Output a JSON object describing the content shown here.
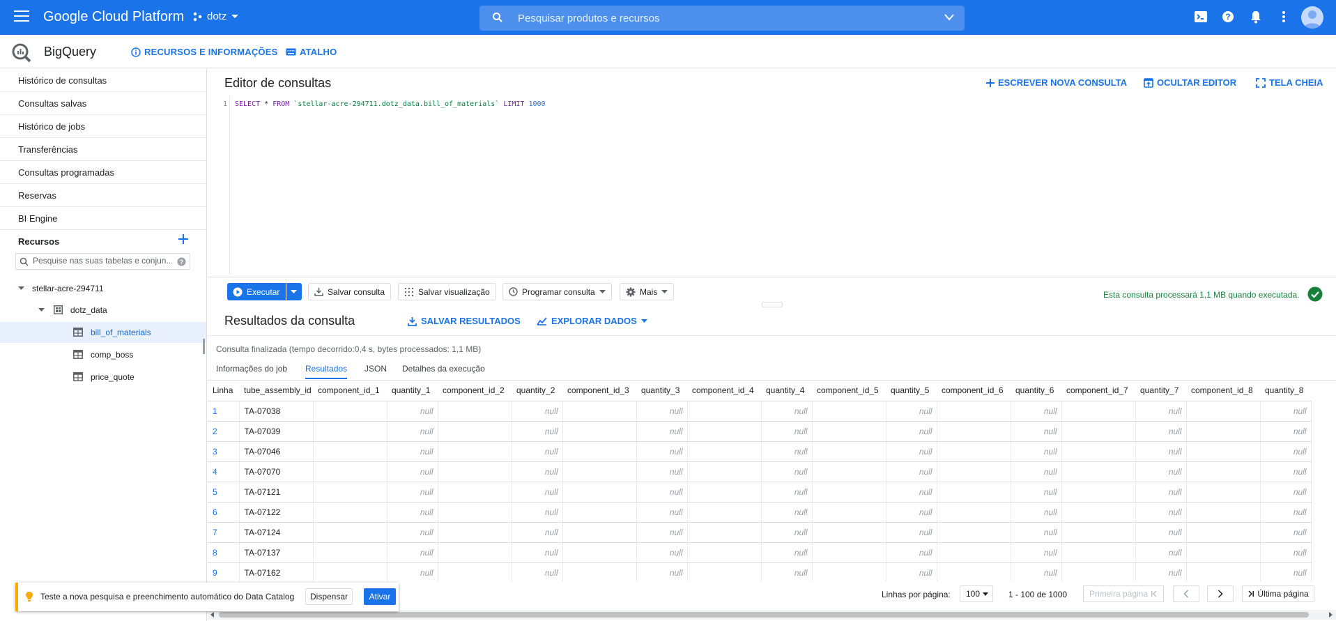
{
  "topbar": {
    "title": "Google Cloud Platform",
    "project": "dotz",
    "search_placeholder": "Pesquisar produtos e recursos"
  },
  "subbar": {
    "product": "BigQuery",
    "resources_link": "RECURSOS E INFORMAÇÕES",
    "shortcut_link": "ATALHO"
  },
  "sidebar": {
    "items": [
      {
        "label": "Histórico de consultas"
      },
      {
        "label": "Consultas salvas"
      },
      {
        "label": "Histórico de jobs"
      },
      {
        "label": "Transferências"
      },
      {
        "label": "Consultas programadas"
      },
      {
        "label": "Reservas"
      },
      {
        "label": "BI Engine"
      }
    ],
    "resources_label": "Recursos",
    "search_placeholder": "Pesquise nas suas tabelas e conjun...",
    "tree": {
      "project": "stellar-acre-294711",
      "dataset": "dotz_data",
      "tables": [
        "bill_of_materials",
        "comp_boss",
        "price_quote"
      ]
    }
  },
  "editor": {
    "title": "Editor de consultas",
    "new_query": "ESCREVER NOVA CONSULTA",
    "hide_editor": "OCULTAR EDITOR",
    "fullscreen": "TELA CHEIA",
    "line_number": "1",
    "sql": {
      "select": "SELECT",
      "star": " * ",
      "from": "FROM",
      "table": " `stellar-acre-294711.dotz_data.bill_of_materials` ",
      "limit": "LIMIT",
      "limit_value": " 1000"
    }
  },
  "toolbar": {
    "run": "Executar",
    "save_query": "Salvar consulta",
    "save_view": "Salvar visualização",
    "schedule": "Programar consulta",
    "more": "Mais",
    "validator": "Esta consulta processará 1,1 MB quando executada."
  },
  "results": {
    "title": "Resultados da consulta",
    "save_results": "SALVAR RESULTADOS",
    "explore_data": "EXPLORAR DADOS",
    "status": "Consulta finalizada (tempo decorrido:0,4 s, bytes processados: 1,1 MB)",
    "tabs": [
      "Informações do job",
      "Resultados",
      "JSON",
      "Detalhes da execução"
    ],
    "columns": [
      "Linha",
      "tube_assembly_id",
      "component_id_1",
      "quantity_1",
      "component_id_2",
      "quantity_2",
      "component_id_3",
      "quantity_3",
      "component_id_4",
      "quantity_4",
      "component_id_5",
      "quantity_5",
      "component_id_6",
      "quantity_6",
      "component_id_7",
      "quantity_7",
      "component_id_8",
      "quantity_8"
    ],
    "null_text": "null",
    "rows": [
      {
        "n": "1",
        "id": "TA-07038"
      },
      {
        "n": "2",
        "id": "TA-07039"
      },
      {
        "n": "3",
        "id": "TA-07046"
      },
      {
        "n": "4",
        "id": "TA-07070"
      },
      {
        "n": "5",
        "id": "TA-07121"
      },
      {
        "n": "6",
        "id": "TA-07122"
      },
      {
        "n": "7",
        "id": "TA-07124"
      },
      {
        "n": "8",
        "id": "TA-07137"
      },
      {
        "n": "9",
        "id": "TA-07162"
      }
    ]
  },
  "pagination": {
    "rows_per_page_label": "Linhas por página:",
    "rows_per_page": "100",
    "range": "1 - 100 de 1000",
    "first_page": "Primeira página",
    "last_page": "Última página"
  },
  "toast": {
    "text": "Teste a nova pesquisa e preenchimento automático do Data Catalog",
    "dismiss": "Dispensar",
    "activate": "Ativar"
  },
  "colors": {
    "brand": "#1a73e8",
    "success": "#188038",
    "warning": "#f9ab00"
  }
}
